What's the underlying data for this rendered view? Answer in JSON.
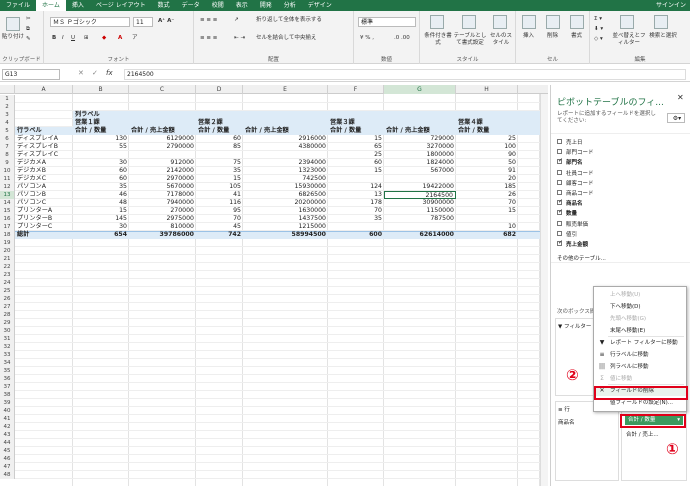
{
  "tabs": [
    "ファイル",
    "ホーム",
    "挿入",
    "ページ レイアウト",
    "数式",
    "データ",
    "校閲",
    "表示",
    "開発",
    "分析",
    "デザイン"
  ],
  "signin": "サインイン",
  "ribbon": {
    "paste": "貼り付け",
    "clipboard": "クリップボード",
    "font_name": "ＭＳ Ｐゴシック",
    "font_size": "11",
    "font_group": "フォント",
    "wrap": "折り返して全体を表示する",
    "merge": "セルを結合して中央揃え",
    "align_group": "配置",
    "number_format": "標準",
    "number_group": "数値",
    "cond_format": "条件付き書式",
    "table_format": "テーブルとして書式設定",
    "cell_style": "セルのスタイル",
    "style_group": "スタイル",
    "insert": "挿入",
    "delete": "削除",
    "format": "書式",
    "cells_group": "セル",
    "sort": "並べ替えとフィルター",
    "find": "検索と選択",
    "edit_group": "編集"
  },
  "formula": {
    "namebox": "G13",
    "fx": "fx",
    "value": "2164500"
  },
  "columns": [
    "A",
    "B",
    "C",
    "D",
    "E",
    "F",
    "G",
    "H"
  ],
  "pivot": {
    "col_label": "列ラベル",
    "groups": [
      "営業１課",
      "営業２課",
      "営業３課",
      "営業４課"
    ],
    "value_headers": [
      "合計 / 数量",
      "合計 / 売上金額"
    ],
    "row_label": "行ラベル",
    "rows": [
      {
        "n": "6",
        "name": "ディスプレイA",
        "v": [
          "130",
          "6129000",
          "60",
          "2916000",
          "15",
          "729000",
          "25"
        ]
      },
      {
        "n": "7",
        "name": "ディスプレイB",
        "v": [
          "55",
          "2790000",
          "85",
          "4380000",
          "65",
          "3270000",
          "100"
        ]
      },
      {
        "n": "8",
        "name": "ディスプレイC",
        "v": [
          "",
          "",
          "",
          "",
          "25",
          "1800000",
          "90"
        ]
      },
      {
        "n": "9",
        "name": "デジカメA",
        "v": [
          "30",
          "912000",
          "75",
          "2394000",
          "60",
          "1824000",
          "50"
        ]
      },
      {
        "n": "10",
        "name": "デジカメB",
        "v": [
          "60",
          "2142000",
          "35",
          "1323000",
          "15",
          "567000",
          "91"
        ]
      },
      {
        "n": "11",
        "name": "デジカメC",
        "v": [
          "60",
          "2970000",
          "15",
          "742500",
          "",
          "",
          "20"
        ]
      },
      {
        "n": "12",
        "name": "パソコンA",
        "v": [
          "35",
          "5670000",
          "105",
          "15930000",
          "124",
          "19422000",
          "185"
        ]
      },
      {
        "n": "13",
        "name": "パソコンB",
        "v": [
          "46",
          "7178000",
          "41",
          "6826500",
          "13",
          "2164500",
          "26"
        ]
      },
      {
        "n": "14",
        "name": "パソコンC",
        "v": [
          "48",
          "7940000",
          "116",
          "20200000",
          "178",
          "30900000",
          "70"
        ]
      },
      {
        "n": "15",
        "name": "プリンターA",
        "v": [
          "15",
          "270000",
          "95",
          "1630000",
          "70",
          "1150000",
          "15"
        ]
      },
      {
        "n": "16",
        "name": "プリンターB",
        "v": [
          "145",
          "2975000",
          "70",
          "1437500",
          "35",
          "787500",
          ""
        ]
      },
      {
        "n": "17",
        "name": "プリンターC",
        "v": [
          "30",
          "810000",
          "45",
          "1215000",
          "",
          "",
          "10"
        ]
      }
    ],
    "total": {
      "n": "18",
      "name": "総計",
      "v": [
        "654",
        "39786000",
        "742",
        "58994500",
        "600",
        "62614000",
        "682"
      ]
    }
  },
  "empty_rows": [
    "19",
    "20",
    "21",
    "22",
    "23",
    "24",
    "25",
    "26",
    "27",
    "28",
    "29",
    "30",
    "31",
    "32",
    "33",
    "34",
    "35",
    "36",
    "37",
    "38",
    "39",
    "40",
    "41",
    "42",
    "43",
    "44",
    "45",
    "46",
    "47",
    "48"
  ],
  "top_rows": [
    "1",
    "2",
    "3",
    "4",
    "5"
  ],
  "fieldpane": {
    "title": "ピボットテーブルのフィ...",
    "subtitle": "レポートに追加するフィールドを選択してください:",
    "fields": [
      {
        "label": "売上日",
        "checked": false
      },
      {
        "label": "部門コード",
        "checked": false
      },
      {
        "label": "部門名",
        "checked": true
      },
      {
        "label": "社員コード",
        "checked": false
      },
      {
        "label": "顧客コード",
        "checked": false
      },
      {
        "label": "商品コード",
        "checked": false
      },
      {
        "label": "商品名",
        "checked": true
      },
      {
        "label": "数量",
        "checked": true
      },
      {
        "label": "販売単価",
        "checked": false
      },
      {
        "label": "値引",
        "checked": false
      },
      {
        "label": "売上金額",
        "checked": true
      }
    ],
    "other_tables": "その他のテーブル...",
    "areas_hint": "次のボックス間",
    "filter": "フィルター",
    "rows": "行",
    "row_field": "商品名",
    "values_a": "合計 / 数量",
    "values_b": "合計 / 売上..."
  },
  "menu": {
    "items": [
      {
        "icon": "",
        "label": "上へ移動(U)",
        "disabled": true
      },
      {
        "icon": "",
        "label": "下へ移動(D)",
        "disabled": false
      },
      {
        "icon": "",
        "label": "先頭へ移動(G)",
        "disabled": true
      },
      {
        "icon": "",
        "label": "末尾へ移動(E)",
        "disabled": false
      },
      {
        "icon": "▼",
        "label": "レポート フィルターに移動",
        "disabled": false
      },
      {
        "icon": "≡",
        "label": "行ラベルに移動",
        "disabled": false
      },
      {
        "icon": "|||",
        "label": "列ラベルに移動",
        "disabled": false
      },
      {
        "icon": "Σ",
        "label": "値に移動",
        "disabled": true
      },
      {
        "icon": "✕",
        "label": "フィールドの削除",
        "disabled": false
      },
      {
        "icon": "",
        "label": "値フィールドの設定(N)...",
        "disabled": false
      }
    ]
  },
  "annot": {
    "one": "①",
    "two": "②"
  }
}
